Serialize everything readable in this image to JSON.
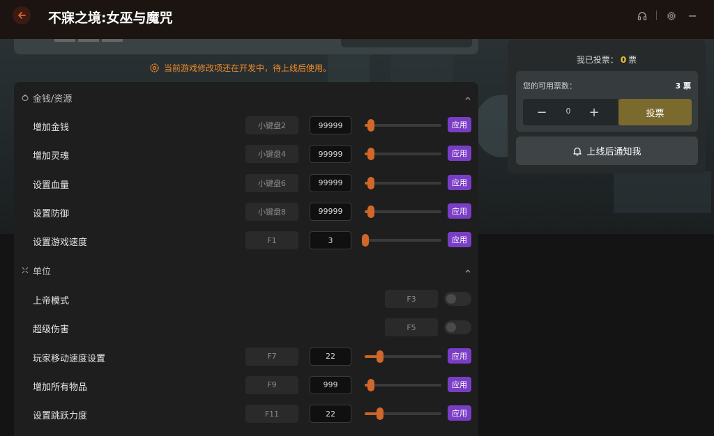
{
  "app": {
    "title": "不寐之境:女巫与魔咒"
  },
  "notice": {
    "text": "当前游戏修改项还在开发中，待上线后使用。"
  },
  "sections": [
    {
      "title": "金钱/资源",
      "rows": [
        {
          "label": "增加金钱",
          "hotkey": "小键盘2",
          "value": "99999",
          "slider_level": 0.08,
          "apply": "应用"
        },
        {
          "label": "增加灵魂",
          "hotkey": "小键盘4",
          "value": "99999",
          "slider_level": 0.08,
          "apply": "应用"
        },
        {
          "label": "设置血量",
          "hotkey": "小键盘6",
          "value": "99999",
          "slider_level": 0.08,
          "apply": "应用"
        },
        {
          "label": "设置防御",
          "hotkey": "小键盘8",
          "value": "99999",
          "slider_level": 0.08,
          "apply": "应用"
        },
        {
          "label": "设置游戏速度",
          "hotkey": "F1",
          "value": "3",
          "slider_level": 0.01,
          "apply": "应用"
        }
      ]
    },
    {
      "title": "单位",
      "rows": [
        {
          "label": "上帝模式",
          "hotkey": "F3",
          "toggle": false
        },
        {
          "label": "超级伤害",
          "hotkey": "F5",
          "toggle": false
        },
        {
          "label": "玩家移动速度设置",
          "hotkey": "F7",
          "value": "22",
          "slider_level": 0.2,
          "apply": "应用"
        },
        {
          "label": "增加所有物品",
          "hotkey": "F9",
          "value": "999",
          "slider_level": 0.08,
          "apply": "应用"
        },
        {
          "label": "设置跳跃力度",
          "hotkey": "F11",
          "value": "22",
          "slider_level": 0.2,
          "apply": "应用"
        }
      ]
    }
  ],
  "vote": {
    "title_prefix": "我已投票：",
    "votes_cast": "0",
    "title_suffix": "票",
    "available_label": "您的可用票数：",
    "available_value": "3 票",
    "stepper_minus": "−",
    "stepper_count": "0",
    "stepper_plus": "+",
    "vote_button": "投票",
    "notify_button": "上线后通知我"
  },
  "colors": {
    "accent": "#d2672a",
    "apply": "#7a3ec6",
    "vote_gold": "#f2c22c",
    "notice": "#f08a2a"
  }
}
